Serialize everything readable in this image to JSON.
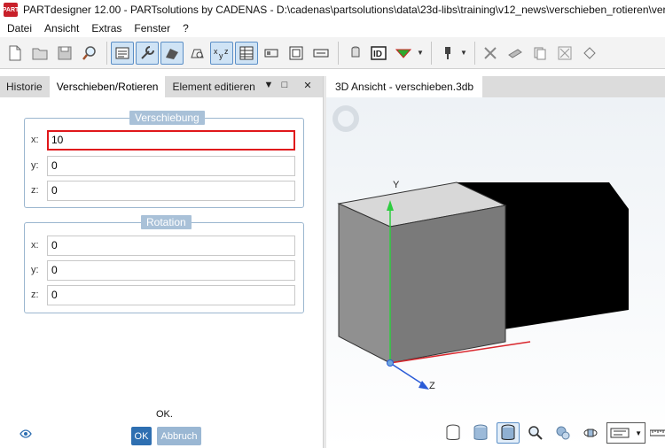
{
  "window": {
    "title": "PARTdesigner 12.00 - PARTsolutions by CADENAS - D:\\cadenas\\partsolutions\\data\\23d-libs\\training\\v12_news\\verschieben_rotieren\\verschieben.prj",
    "app_icon_text": "PART"
  },
  "menubar": {
    "items": [
      "Datei",
      "Ansicht",
      "Extras",
      "Fenster",
      "?"
    ]
  },
  "left_panel": {
    "tabs": [
      "Historie",
      "Verschieben/Rotieren",
      "Element editieren"
    ],
    "tab_dropdown": "▼",
    "tab_pin": "□",
    "tab_close": "✕"
  },
  "verschiebung": {
    "title": "Verschiebung",
    "x_label": "x:",
    "x_value": "10",
    "y_label": "y:",
    "y_value": "0",
    "z_label": "z:",
    "z_value": "0"
  },
  "rotation": {
    "title": "Rotation",
    "x_label": "x:",
    "x_value": "0",
    "y_label": "y:",
    "y_value": "0",
    "z_label": "z:",
    "z_value": "0"
  },
  "footer": {
    "status_text": "OK.",
    "ok_label": "OK",
    "cancel_label": "Abbruch"
  },
  "view": {
    "tab_label": "3D Ansicht - verschieben.3db",
    "axis_y": "Y",
    "axis_z": "Z"
  },
  "colors": {
    "highlight_border": "#e0171b",
    "group_title_bg": "#a9c1d8",
    "ok_button": "#2e6fb1",
    "cancel_button": "#9ab7d3",
    "axis_y": "#2ecc40",
    "axis_x": "#d9262c",
    "axis_z": "#2a5bd7"
  },
  "icons": {
    "toolbar": [
      "new-document-icon",
      "open-folder-icon",
      "save-icon",
      "search-magnifier-icon",
      "sketch-frame-icon",
      "wrench-icon",
      "extrude-icon",
      "shape-icon",
      "xyz-variables-icon",
      "table-icon",
      "grid-icon",
      "layout-icon",
      "arrows-icon",
      "bottle-icon",
      "id-icon",
      "triangle-icon",
      "plug-icon",
      "cut-icon",
      "clamp-icon",
      "copy-icon",
      "expand-icon",
      "transform-icon"
    ],
    "viewport": [
      "wireframe-cylinder-icon",
      "shaded-cylinder-icon",
      "solid-cylinder-icon",
      "zoom-icon",
      "spheres-icon",
      "rotate-icon",
      "view-dropdown-icon",
      "ruler-icon"
    ]
  }
}
